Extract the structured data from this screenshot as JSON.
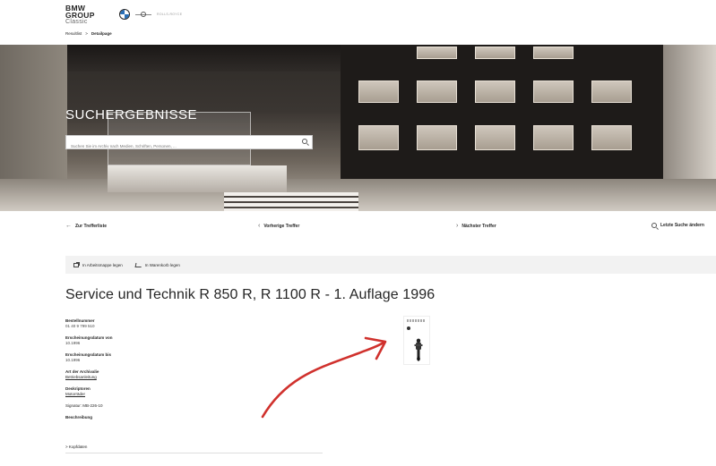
{
  "header": {
    "logo_line1": "BMW",
    "logo_line2": "GROUP",
    "logo_line3": "Classic",
    "rr_text": "ROLLS-ROYCE",
    "breadcrumb": {
      "item1": "Resultlist",
      "separator": ">",
      "item2": "Detailpage"
    }
  },
  "hero": {
    "title": "SUCHERGEBNISSE",
    "search_placeholder": "Suchen Sie im Archiv nach Medien, Schriften, Personen, ..."
  },
  "nav": {
    "back": "Zur Trefferliste",
    "prev": "Vorherige Treffer",
    "next": "Nächster Treffer",
    "last_search": "Letzte Suche ändern"
  },
  "actions": {
    "workfolder": "In Arbeitsmappe legen",
    "cart": "In Warenkorb legen"
  },
  "document": {
    "title": "Service und Technik R 850 R, R 1100 R - 1. Auflage 1996",
    "fields": [
      {
        "label": "Bestellnummer",
        "value": "01 40 9 799 510"
      },
      {
        "label": "Erscheinungsdatum von",
        "value": "10.1996"
      },
      {
        "label": "Erscheinungsdatum bis",
        "value": "10.1996"
      },
      {
        "label": "Art der Archivalie",
        "link": "Betriebsanleitung"
      },
      {
        "label": "Deskriptoren",
        "link": "Motorräder"
      }
    ],
    "signature": "Signatur: MB-226-10",
    "description_label": "Beschreibung",
    "kopfdaten": "Kopfdaten"
  },
  "icons": {
    "back": "arrow-left-icon",
    "prev": "chevron-left-icon",
    "next": "chevron-right-icon",
    "search": "search-icon",
    "workfolder": "folder-edit-icon",
    "cart": "cart-icon"
  },
  "colors": {
    "annotation_arrow": "#d0312d",
    "action_bar_bg": "#f2f2f2",
    "text": "#262626"
  }
}
